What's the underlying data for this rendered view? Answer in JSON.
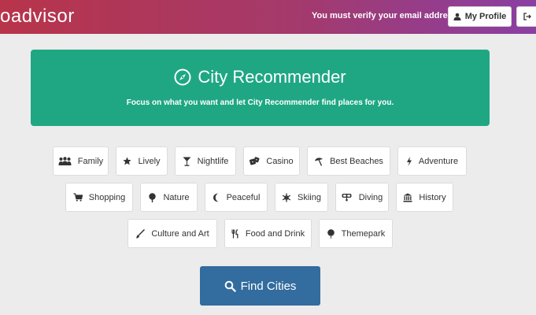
{
  "header": {
    "logo_text": "oadvisor",
    "verify_message": "You must verify your email address",
    "profile_label": "My Profile",
    "profile_icon": "user-icon",
    "logout_icon": "logout-icon",
    "gradient_colors": [
      "#b8344a",
      "#8a3fa3"
    ]
  },
  "hero": {
    "icon": "compass-icon",
    "title": "City Recommender",
    "subtitle": "Focus on what you want and let City Recommender find places for you.",
    "color": "#1fa784"
  },
  "categories": [
    {
      "label": "Family",
      "icon": "family-icon"
    },
    {
      "label": "Lively",
      "icon": "star-icon"
    },
    {
      "label": "Nightlife",
      "icon": "cocktail-icon"
    },
    {
      "label": "Casino",
      "icon": "dice-icon"
    },
    {
      "label": "Best Beaches",
      "icon": "umbrella-icon"
    },
    {
      "label": "Adventure",
      "icon": "lightning-icon"
    },
    {
      "label": "Shopping",
      "icon": "cart-icon"
    },
    {
      "label": "Nature",
      "icon": "tree-icon"
    },
    {
      "label": "Peaceful",
      "icon": "moon-icon"
    },
    {
      "label": "Skiing",
      "icon": "snowflake-icon"
    },
    {
      "label": "Diving",
      "icon": "diving-mask-icon"
    },
    {
      "label": "History",
      "icon": "museum-icon"
    },
    {
      "label": "Culture and Art",
      "icon": "brush-icon"
    },
    {
      "label": "Food and Drink",
      "icon": "cutlery-icon"
    },
    {
      "label": "Themepark",
      "icon": "balloon-icon"
    }
  ],
  "find_button": {
    "label": "Find Cities",
    "icon": "search-icon",
    "color": "#336c9e"
  }
}
